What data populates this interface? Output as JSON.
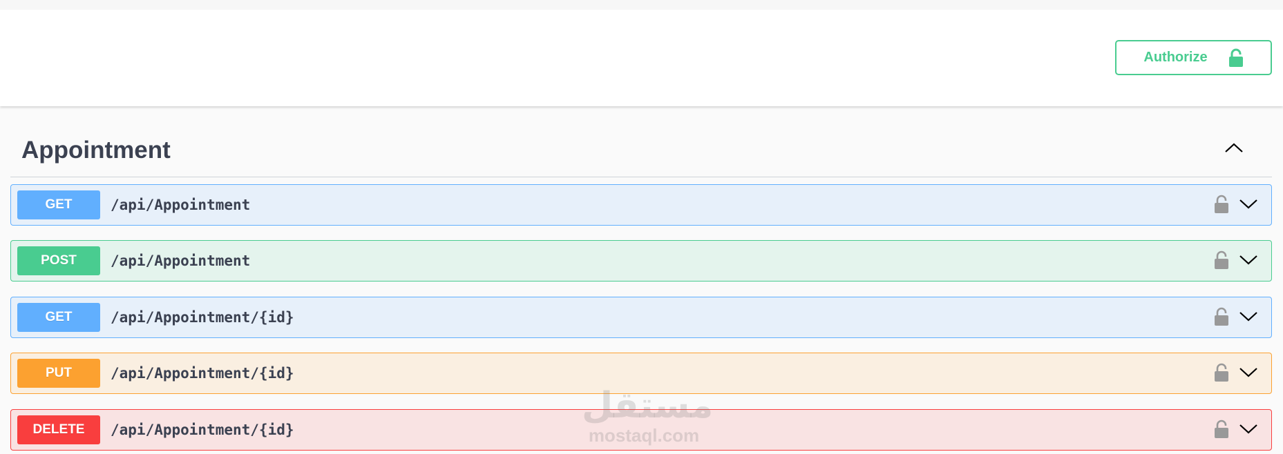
{
  "header": {
    "authorize_label": "Authorize",
    "authorize_icon": "unlocked-padlock-icon",
    "accent_color": "#49cc90"
  },
  "section": {
    "title": "Appointment",
    "collapse_icon": "chevron-up-icon"
  },
  "operations": [
    {
      "method": "GET",
      "path": "/api/Appointment",
      "color": "#61affe"
    },
    {
      "method": "POST",
      "path": "/api/Appointment",
      "color": "#49cc90"
    },
    {
      "method": "GET",
      "path": "/api/Appointment/{id}",
      "color": "#61affe"
    },
    {
      "method": "PUT",
      "path": "/api/Appointment/{id}",
      "color": "#fca130"
    },
    {
      "method": "DELETE",
      "path": "/api/Appointment/{id}",
      "color": "#f93e3e"
    }
  ],
  "operation_icons": {
    "lock": "padlock-icon",
    "expand": "chevron-down-icon"
  },
  "watermark": {
    "logo_text": "مستقل",
    "site": "mostaql.com"
  }
}
